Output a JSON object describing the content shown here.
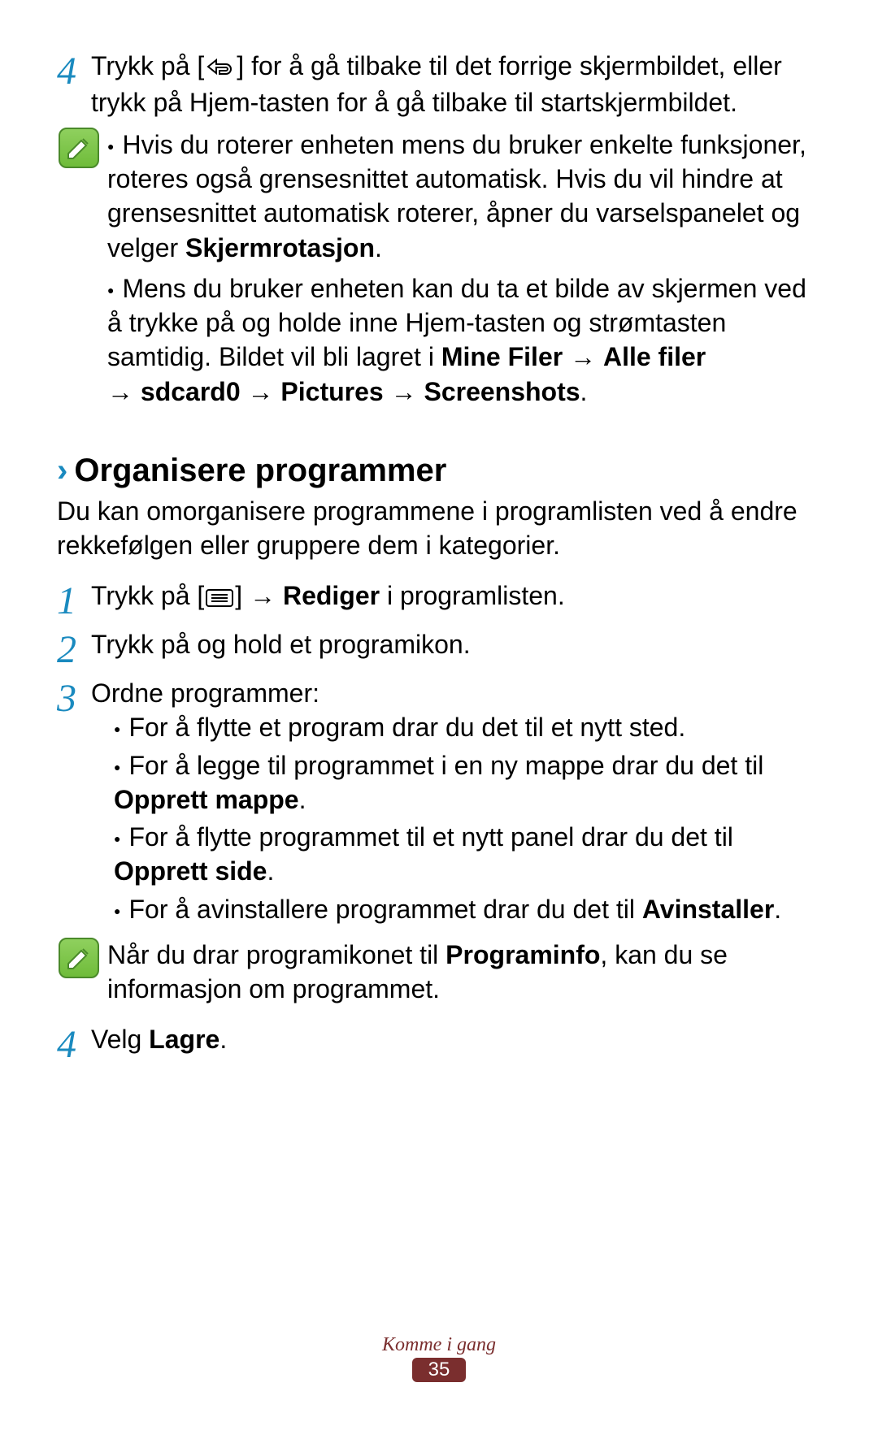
{
  "step4top": {
    "num": "4",
    "prefix": "Trykk på [",
    "suffix": "] for å gå tilbake til det forrige skjermbildet, eller trykk på Hjem-tasten for å gå tilbake til startskjermbildet."
  },
  "note1": {
    "item1_a": "Hvis du roterer enheten mens du bruker enkelte funksjoner, roteres også grensesnittet automatisk. Hvis du vil hindre at grensesnittet automatisk roterer, åpner du varselspanelet og velger ",
    "item1_b": "Skjermrotasjon",
    "item1_c": ".",
    "item2_a": "Mens du bruker enheten kan du ta et bilde av skjermen ved å trykke på og holde inne Hjem-tasten og strømtasten samtidig. Bildet vil bli lagret i ",
    "item2_b": "Mine Filer",
    "item2_c": " → ",
    "item2_d": "Alle filer",
    "item2_e": " → ",
    "item2_f": "sdcard0",
    "item2_g": " → ",
    "item2_h": "Pictures",
    "item2_i": " → ",
    "item2_j": "Screenshots",
    "item2_k": "."
  },
  "heading": "Organisere programmer",
  "intro": "Du kan omorganisere programmene i programlisten ved å endre rekkefølgen eller gruppere dem i kategorier.",
  "step1": {
    "num": "1",
    "prefix": "Trykk på [",
    "mid": "] → ",
    "bold": "Rediger",
    "suffix": " i programlisten."
  },
  "step2": {
    "num": "2",
    "text": "Trykk på og hold et programikon."
  },
  "step3": {
    "num": "3",
    "text": "Ordne programmer:",
    "li1": "For å flytte et program drar du det til et nytt sted.",
    "li2_a": "For å legge til programmet i en ny mappe drar du det til ",
    "li2_b": "Opprett mappe",
    "li2_c": ".",
    "li3_a": "For å flytte programmet til et nytt panel drar du det til ",
    "li3_b": "Opprett side",
    "li3_c": ".",
    "li4_a": "For å avinstallere programmet drar du det til ",
    "li4_b": "Avinstaller",
    "li4_c": "."
  },
  "note2": {
    "a": "Når du drar programikonet til ",
    "b": "Programinfo",
    "c": ", kan du se informasjon om programmet."
  },
  "step4bottom": {
    "num": "4",
    "a": "Velg ",
    "b": "Lagre",
    "c": "."
  },
  "footer": {
    "title": "Komme i gang",
    "page": "35"
  }
}
